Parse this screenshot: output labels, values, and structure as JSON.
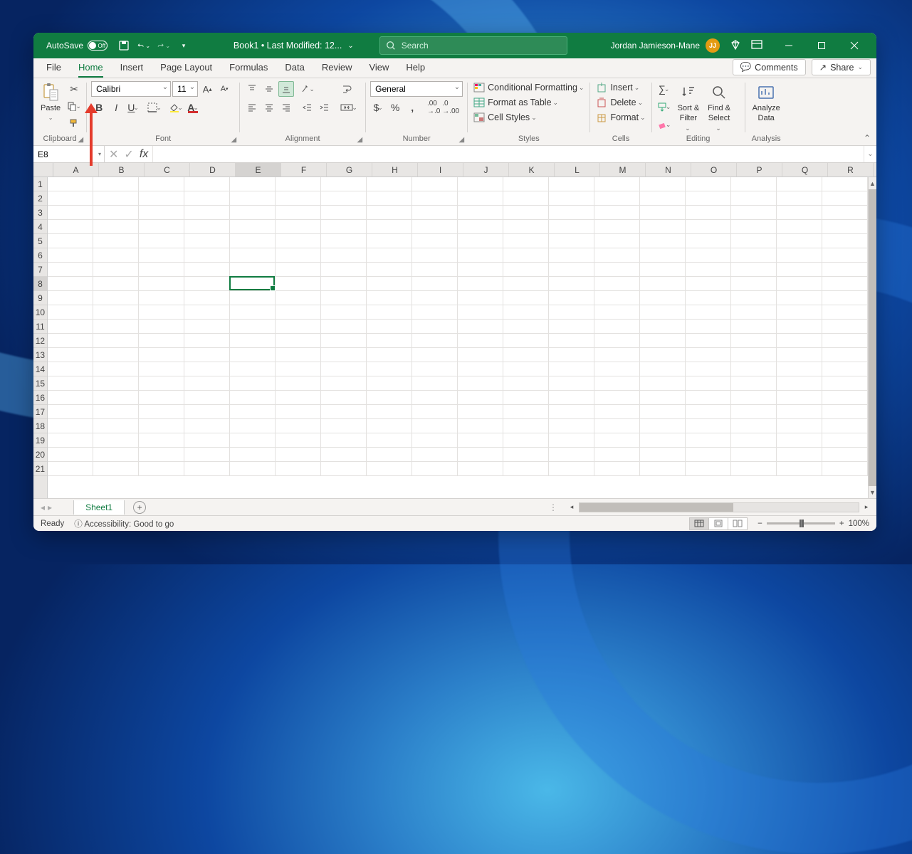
{
  "titlebar": {
    "autosave_label": "AutoSave",
    "autosave_state": "Off",
    "doc_title": "Book1 • Last Modified: 12...",
    "search_placeholder": "Search",
    "user_name": "Jordan Jamieson-Mane",
    "user_initials": "JJ"
  },
  "tabs": [
    "File",
    "Home",
    "Insert",
    "Page Layout",
    "Formulas",
    "Data",
    "Review",
    "View",
    "Help"
  ],
  "active_tab": "Home",
  "tab_right": {
    "comments": "Comments",
    "share": "Share"
  },
  "ribbon": {
    "clipboard": {
      "paste": "Paste",
      "label": "Clipboard"
    },
    "font": {
      "name": "Calibri",
      "size": "11",
      "label": "Font"
    },
    "alignment": {
      "label": "Alignment"
    },
    "number": {
      "format": "General",
      "label": "Number"
    },
    "styles": {
      "conditional": "Conditional Formatting",
      "table": "Format as Table",
      "cell": "Cell Styles",
      "label": "Styles"
    },
    "cells": {
      "insert": "Insert",
      "delete": "Delete",
      "format": "Format",
      "label": "Cells"
    },
    "editing": {
      "sort": "Sort &",
      "filter": "Filter",
      "find": "Find &",
      "select": "Select",
      "label": "Editing"
    },
    "analysis": {
      "analyze": "Analyze",
      "data": "Data",
      "label": "Analysis"
    }
  },
  "namebox": "E8",
  "columns": [
    "A",
    "B",
    "C",
    "D",
    "E",
    "F",
    "G",
    "H",
    "I",
    "J",
    "K",
    "L",
    "M",
    "N",
    "O",
    "P",
    "Q",
    "R"
  ],
  "row_count": 21,
  "selected": {
    "col": "E",
    "row": 8,
    "col_index": 4,
    "row_index": 7
  },
  "sheet_tab": "Sheet1",
  "status": {
    "ready": "Ready",
    "accessibility": "Accessibility: Good to go",
    "zoom": "100%"
  }
}
